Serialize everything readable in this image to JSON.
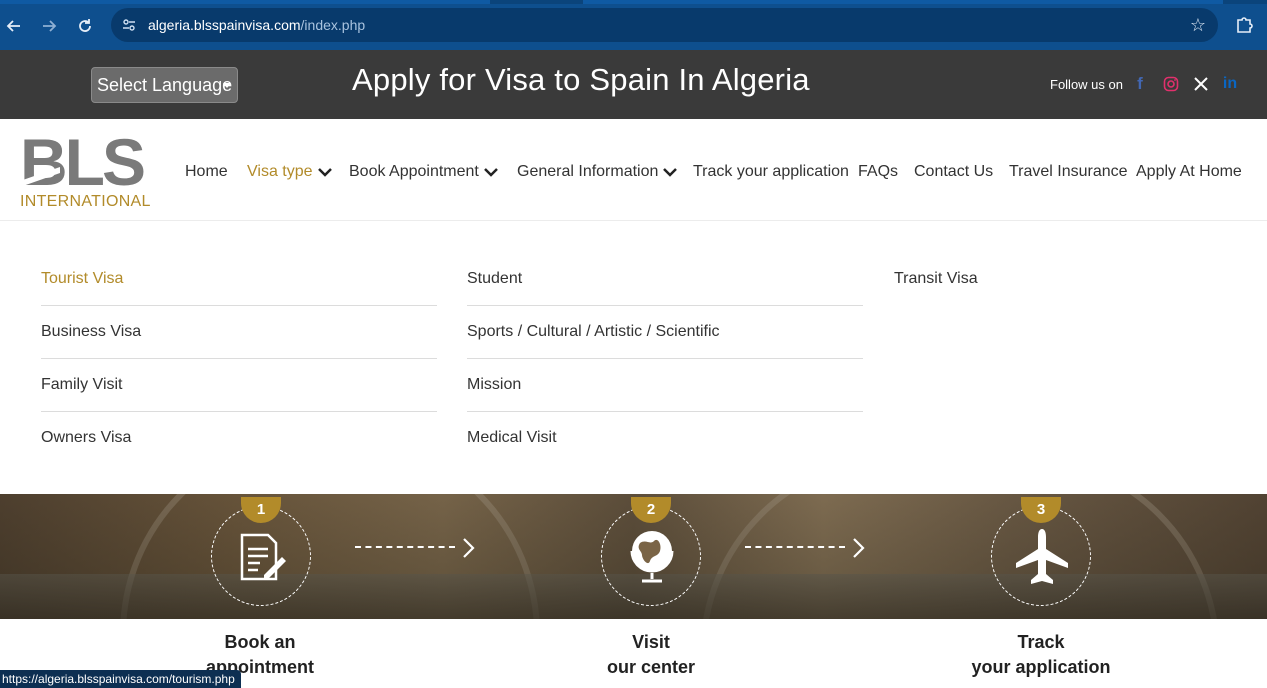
{
  "browser": {
    "url_host": "algeria.blsspainvisa.com",
    "url_path": "/index.php",
    "back_icon": "back-arrow-icon",
    "forward_icon": "forward-arrow-icon",
    "reload_icon": "reload-icon",
    "bookmark_icon": "star-icon",
    "extensions_icon": "puzzle-icon",
    "status_url": "https://algeria.blsspainvisa.com/tourism.php"
  },
  "header": {
    "language_select": "Select Language",
    "title": "Apply for Visa to Spain In Algeria",
    "follow_us": "Follow us on",
    "socials": [
      "facebook-icon",
      "instagram-icon",
      "x-icon",
      "linkedin-icon"
    ],
    "colors": {
      "header_bg": "#3a3a3a",
      "accent": "#b28b2a",
      "facebook": "#4267b2",
      "instagram": "#e1306c",
      "linkedin": "#0a66c2"
    }
  },
  "logo": {
    "text": "BLS",
    "sub": "INTERNATIONAL"
  },
  "nav": {
    "home": "Home",
    "visa_type": "Visa type",
    "book_appointment": "Book Appointment",
    "general_information": "General Information",
    "track": "Track your application",
    "faqs": "FAQs",
    "contact": "Contact Us",
    "travel_insurance": "Travel Insurance",
    "apply_at_home": "Apply At Home"
  },
  "dropdown": {
    "col1": [
      "Tourist Visa",
      "Business Visa",
      "Family Visit",
      "Owners Visa"
    ],
    "col2": [
      "Student",
      "Sports / Cultural / Artistic / Scientific",
      "Mission",
      "Medical Visit"
    ],
    "col3": [
      "Transit Visa"
    ]
  },
  "steps": [
    {
      "num": "1",
      "icon": "document-pen-icon",
      "line1": "Book an",
      "line2": "appointment"
    },
    {
      "num": "2",
      "icon": "globe-icon",
      "line1": "Visit",
      "line2": "our center"
    },
    {
      "num": "3",
      "icon": "airplane-icon",
      "line1": "Track",
      "line2": "your application"
    }
  ]
}
